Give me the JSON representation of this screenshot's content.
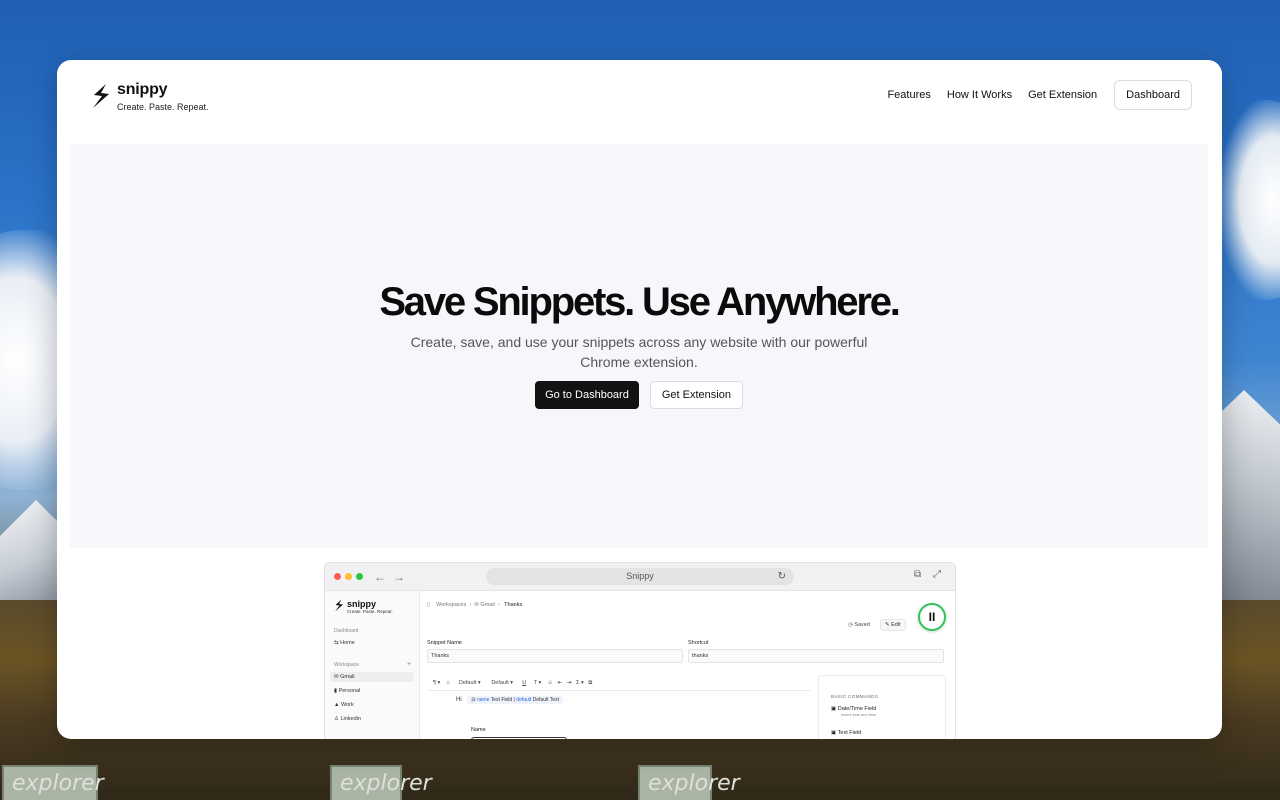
{
  "background": {
    "sign_text": "explorer"
  },
  "header": {
    "brand_name": "snippy",
    "brand_tagline": "Create. Paste. Repeat.",
    "nav": [
      "Features",
      "How It Works",
      "Get Extension"
    ],
    "dashboard_label": "Dashboard"
  },
  "hero": {
    "title": "Save Snippets. Use Anywhere.",
    "subtitle_line1": "Create, save, and use your snippets across any website with our powerful",
    "subtitle_line2": "Chrome extension.",
    "primary_cta": "Go to Dashboard",
    "secondary_cta": "Get Extension"
  },
  "mockup": {
    "url": "Snippy",
    "sidebar": {
      "brand_name": "snippy",
      "brand_tagline": "Create. Paste. Repeat.",
      "dashboard_section": "Dashboard",
      "home": "Home",
      "workspace_section": "Workspace",
      "add": "+",
      "items": [
        "Gmail",
        "Personal",
        "Work",
        "Linkedin"
      ]
    },
    "breadcrumb": [
      "Workspaces",
      "Gmail",
      "Thanks"
    ],
    "saved_label": "Saved",
    "edit_label": "Edit",
    "snippet_name_label": "Snippet Name",
    "snippet_name_value": "Thanks",
    "shortcut_label": "Shortcut",
    "shortcut_value": "thanks",
    "toolbar": [
      "Default",
      "Default",
      "U",
      "T"
    ],
    "editor_text": "Hi",
    "chip": {
      "key1": "name",
      "val1": "Text Field",
      "key2": "default",
      "val2": "Default Text"
    },
    "panel_heading": "BASIC COMMANDS",
    "commands": [
      {
        "title": "Date/Time Field",
        "desc": "Insert date and time"
      },
      {
        "title": "Text Field",
        "desc": ""
      }
    ],
    "name_label": "Name"
  },
  "colors": {
    "accent_green": "#32c25a",
    "primary_button": "#121212",
    "hero_bg": "#f7f7fb"
  }
}
